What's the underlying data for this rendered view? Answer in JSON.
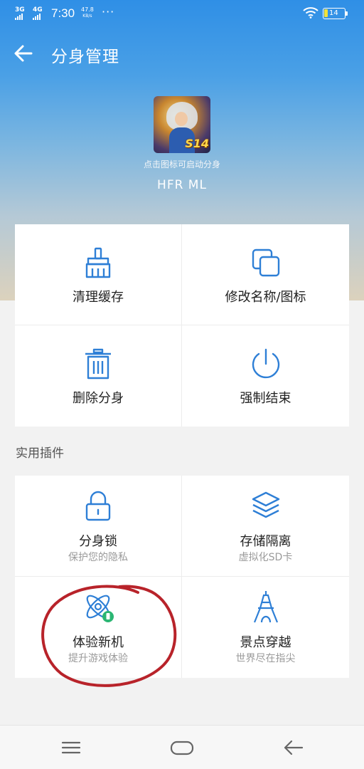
{
  "status_bar": {
    "sig1": "3G",
    "sig2": "4G",
    "time": "7:30",
    "speed_value": "47.8",
    "speed_unit": "KB/s",
    "dots": "···",
    "battery": "14"
  },
  "app_bar": {
    "title": "分身管理"
  },
  "app": {
    "icon_badge": "S14",
    "hint": "点击图标可启动分身",
    "name": "HFR ML"
  },
  "actions": [
    {
      "label": "清理缓存",
      "icon": "broom-icon"
    },
    {
      "label": "修改名称/图标",
      "icon": "copy-icon"
    },
    {
      "label": "删除分身",
      "icon": "trash-icon"
    },
    {
      "label": "强制结束",
      "icon": "power-icon"
    }
  ],
  "plugins_section": {
    "title": "实用插件",
    "items": [
      {
        "label": "分身锁",
        "sub": "保护您的隐私",
        "icon": "lock-icon"
      },
      {
        "label": "存储隔离",
        "sub": "虚拟化SD卡",
        "icon": "layers-icon"
      },
      {
        "label": "体验新机",
        "sub": "提升游戏体验",
        "icon": "atom-icon"
      },
      {
        "label": "景点穿越",
        "sub": "世界尽在指尖",
        "icon": "eiffel-tower-icon"
      }
    ]
  },
  "colors": {
    "accent_icon": "#2e7fd6",
    "annotation_circle": "#b8232a",
    "header_top": "#2f8fe6"
  }
}
